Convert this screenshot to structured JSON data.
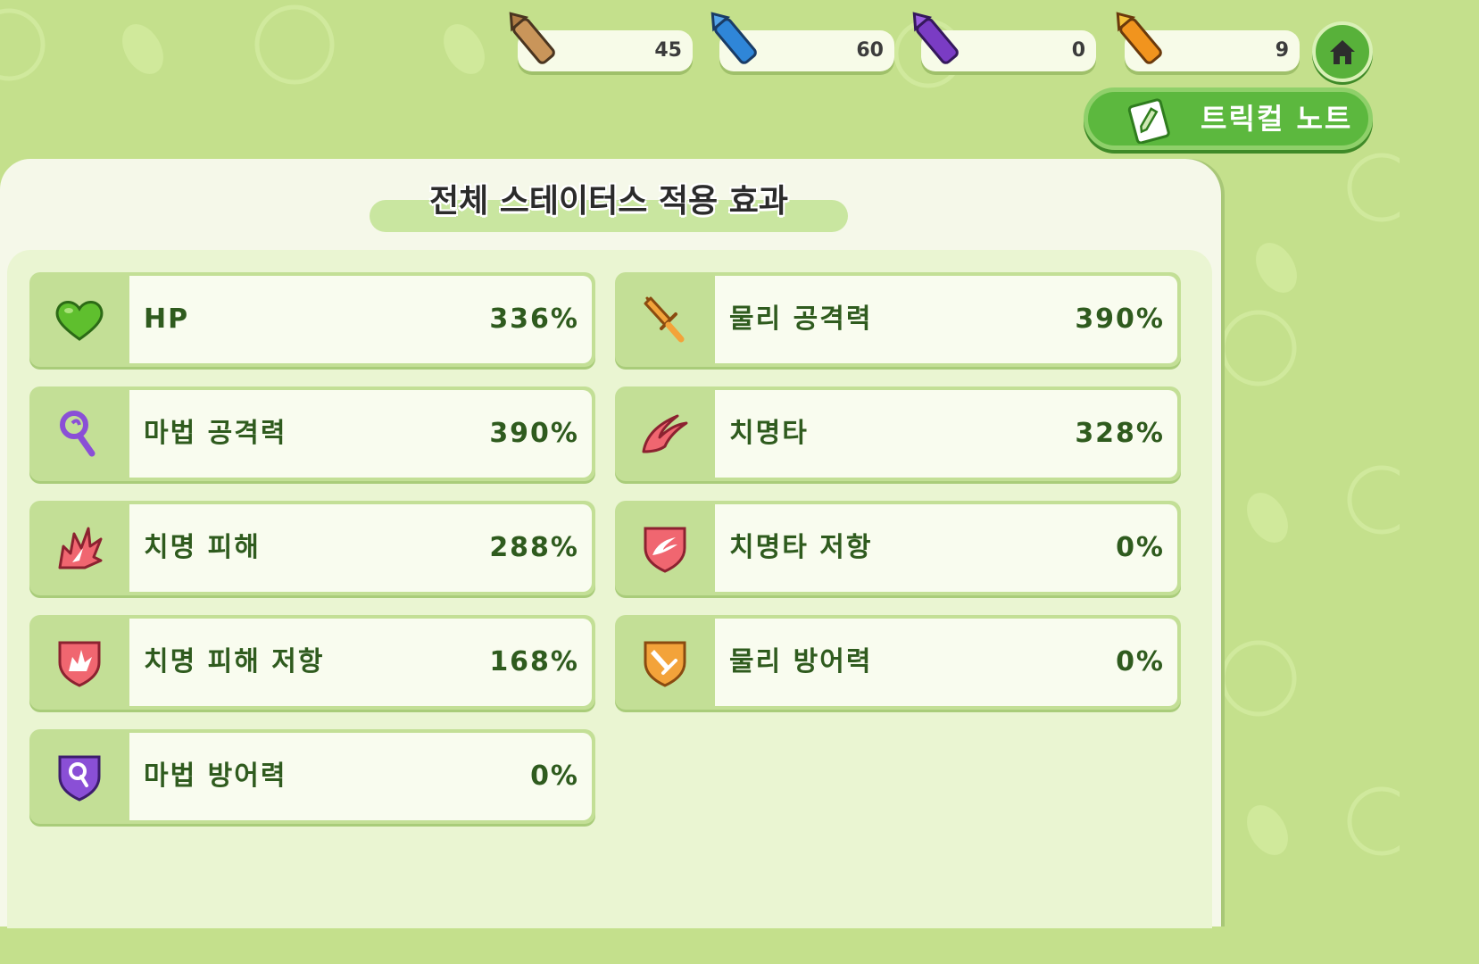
{
  "currencies": [
    {
      "name": "brown-crayon",
      "value": "45",
      "color": "#c9955a"
    },
    {
      "name": "blue-crayon",
      "value": "60",
      "color": "#2f86d8"
    },
    {
      "name": "purple-crayon",
      "value": "0",
      "color": "#7a3cc4"
    },
    {
      "name": "orange-crayon",
      "value": "9",
      "color": "#f1941e"
    }
  ],
  "note_button": {
    "label": "트릭컬 노트"
  },
  "panel": {
    "title": "전체 스테이터스 적용 효과"
  },
  "stats": [
    {
      "label": "HP",
      "value": "336%",
      "icon": "heart-icon"
    },
    {
      "label": "물리 공격력",
      "value": "390%",
      "icon": "sword-icon"
    },
    {
      "label": "마법 공격력",
      "value": "390%",
      "icon": "magic-wand-icon"
    },
    {
      "label": "치명타",
      "value": "328%",
      "icon": "critical-slash-icon"
    },
    {
      "label": "치명 피해",
      "value": "288%",
      "icon": "critical-burst-icon"
    },
    {
      "label": "치명타 저항",
      "value": "0%",
      "icon": "critical-resist-shield-icon"
    },
    {
      "label": "치명 피해 저항",
      "value": "168%",
      "icon": "critical-damage-resist-shield-icon"
    },
    {
      "label": "물리 방어력",
      "value": "0%",
      "icon": "physical-defense-shield-icon"
    },
    {
      "label": "마법 방어력",
      "value": "0%",
      "icon": "magic-defense-shield-icon"
    }
  ],
  "colors": {
    "background": "#c4e08c",
    "panel": "#f5f8e9",
    "card_border": "#c3df96",
    "text": "#2f5b1e",
    "accent_green": "#5cb83e"
  }
}
